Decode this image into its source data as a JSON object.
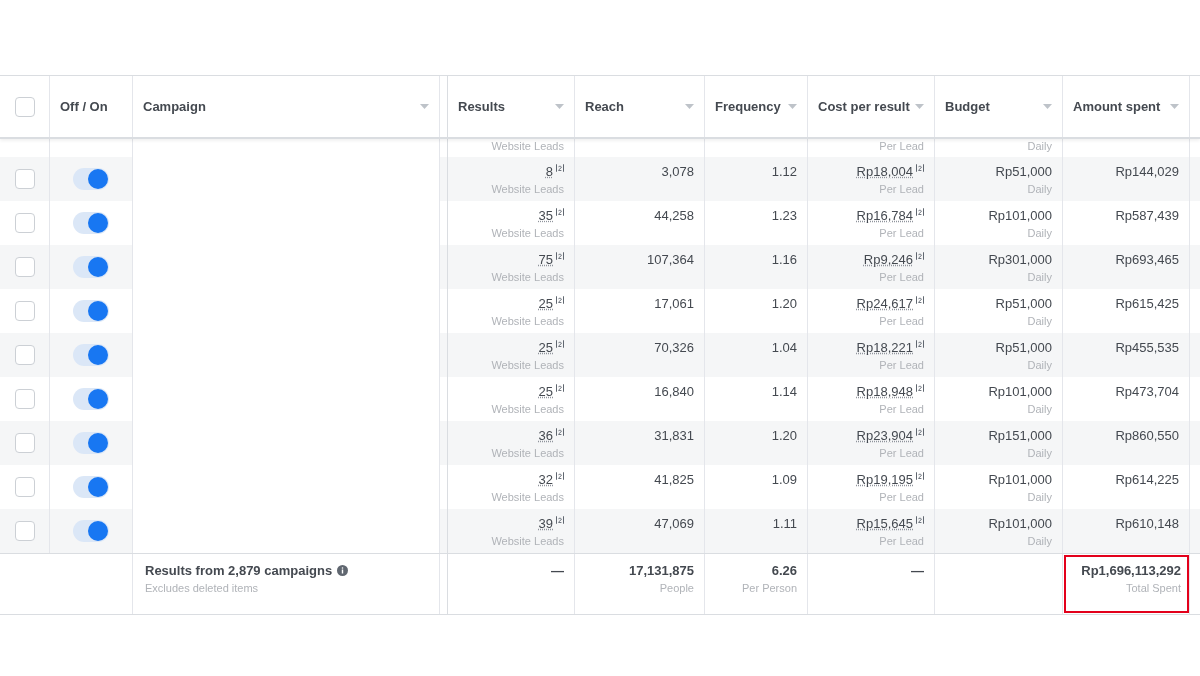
{
  "table": {
    "select_all_checked": false,
    "columns": [
      {
        "label": "Off / On",
        "sortable": false
      },
      {
        "label": "Campaign",
        "sortable": true
      },
      {
        "label": "Results",
        "sortable": true
      },
      {
        "label": "Reach",
        "sortable": true
      },
      {
        "label": "Frequency",
        "sortable": true
      },
      {
        "label": "Cost per result",
        "sortable": true
      },
      {
        "label": "Budget",
        "sortable": true
      },
      {
        "label": "Amount spent",
        "sortable": true
      }
    ],
    "partial_row": {
      "results_sub": "Website Leads",
      "cost_sub": "Per Lead",
      "budget_sub": "Daily"
    },
    "rows": [
      {
        "checked": false,
        "on": true,
        "results": "8",
        "results_sub": "Website Leads",
        "reach": "3,078",
        "frequency": "1.12",
        "cost": "Rp18,004",
        "cost_sub": "Per Lead",
        "budget": "Rp51,000",
        "budget_sub": "Daily",
        "spent": "Rp144,029"
      },
      {
        "checked": false,
        "on": true,
        "results": "35",
        "results_sub": "Website Leads",
        "reach": "44,258",
        "frequency": "1.23",
        "cost": "Rp16,784",
        "cost_sub": "Per Lead",
        "budget": "Rp101,000",
        "budget_sub": "Daily",
        "spent": "Rp587,439"
      },
      {
        "checked": false,
        "on": true,
        "results": "75",
        "results_sub": "Website Leads",
        "reach": "107,364",
        "frequency": "1.16",
        "cost": "Rp9,246",
        "cost_sub": "Per Lead",
        "budget": "Rp301,000",
        "budget_sub": "Daily",
        "spent": "Rp693,465"
      },
      {
        "checked": false,
        "on": true,
        "results": "25",
        "results_sub": "Website Leads",
        "reach": "17,061",
        "frequency": "1.20",
        "cost": "Rp24,617",
        "cost_sub": "Per Lead",
        "budget": "Rp51,000",
        "budget_sub": "Daily",
        "spent": "Rp615,425"
      },
      {
        "checked": false,
        "on": true,
        "results": "25",
        "results_sub": "Website Leads",
        "reach": "70,326",
        "frequency": "1.04",
        "cost": "Rp18,221",
        "cost_sub": "Per Lead",
        "budget": "Rp51,000",
        "budget_sub": "Daily",
        "spent": "Rp455,535"
      },
      {
        "checked": false,
        "on": true,
        "results": "25",
        "results_sub": "Website Leads",
        "reach": "16,840",
        "frequency": "1.14",
        "cost": "Rp18,948",
        "cost_sub": "Per Lead",
        "budget": "Rp101,000",
        "budget_sub": "Daily",
        "spent": "Rp473,704"
      },
      {
        "checked": false,
        "on": true,
        "results": "36",
        "results_sub": "Website Leads",
        "reach": "31,831",
        "frequency": "1.20",
        "cost": "Rp23,904",
        "cost_sub": "Per Lead",
        "budget": "Rp151,000",
        "budget_sub": "Daily",
        "spent": "Rp860,550"
      },
      {
        "checked": false,
        "on": true,
        "results": "32",
        "results_sub": "Website Leads",
        "reach": "41,825",
        "frequency": "1.09",
        "cost": "Rp19,195",
        "cost_sub": "Per Lead",
        "budget": "Rp101,000",
        "budget_sub": "Daily",
        "spent": "Rp614,225"
      },
      {
        "checked": false,
        "on": true,
        "results": "39",
        "results_sub": "Website Leads",
        "reach": "47,069",
        "frequency": "1.11",
        "cost": "Rp15,645",
        "cost_sub": "Per Lead",
        "budget": "Rp101,000",
        "budget_sub": "Daily",
        "spent": "Rp610,148"
      }
    ],
    "footer": {
      "title": "Results from 2,879 campaigns",
      "note": "Excludes deleted items",
      "results": "—",
      "reach": "17,131,875",
      "reach_sub": "People",
      "frequency": "6.26",
      "frequency_sub": "Per Person",
      "cost": "—",
      "spent": "Rp1,696,113,292",
      "spent_sub": "Total Spent",
      "spent_highlighted": true
    }
  }
}
